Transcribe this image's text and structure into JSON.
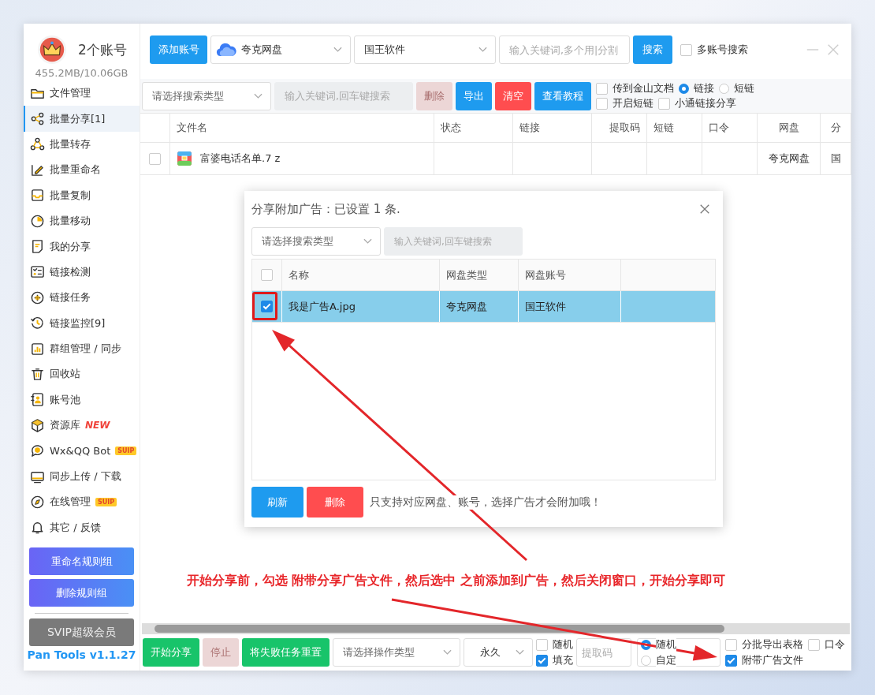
{
  "header": {
    "account_count": "2个账号",
    "storage": "455.2MB/10.06GB",
    "add_account_button": "添加账号",
    "drive_select": "夸克网盘",
    "account_select": "国王软件",
    "keyword_field": {
      "placeholder": "输入关键词,多个用|分割"
    },
    "search_button": "搜索",
    "multi_account_search": {
      "label": "多账号搜索",
      "checked": false
    }
  },
  "sidebar": {
    "items": [
      {
        "label": "文件管理",
        "selected": false
      },
      {
        "label": "批量分享[1]",
        "selected": true
      },
      {
        "label": "批量转存",
        "selected": false
      },
      {
        "label": "批量重命名",
        "selected": false
      },
      {
        "label": "批量复制",
        "selected": false
      },
      {
        "label": "批量移动",
        "selected": false
      },
      {
        "label": "我的分享",
        "selected": false
      },
      {
        "label": "链接检测",
        "selected": false
      },
      {
        "label": "链接任务",
        "selected": false
      },
      {
        "label": "链接监控[9]",
        "selected": false
      },
      {
        "label": "群组管理 / 同步",
        "selected": false
      },
      {
        "label": "回收站",
        "selected": false
      },
      {
        "label": "账号池",
        "selected": false
      },
      {
        "label": "资源库",
        "selected": false,
        "badge": {
          "text": "NEW",
          "kind": "new"
        }
      },
      {
        "label": "Wx&QQ Bot",
        "selected": false,
        "badge": {
          "text": "SUIP",
          "kind": "suip"
        }
      },
      {
        "label": "同步上传 / 下载",
        "selected": false
      },
      {
        "label": "在线管理",
        "selected": false,
        "badge": {
          "text": "SUIP",
          "kind": "suip"
        }
      },
      {
        "label": "其它 / 反馈",
        "selected": false
      }
    ],
    "rule_buttons": [
      "重命名规则组",
      "删除规则组"
    ],
    "svip_button": "SVIP超级会员",
    "version": "Pan Tools v1.1.27"
  },
  "toolbar": {
    "search_type_select": {
      "placeholder": "请选择搜索类型"
    },
    "keyword_field": {
      "placeholder": "输入关键词,回车键搜索"
    },
    "buttons": [
      {
        "label": "删除",
        "kind": "danger",
        "disabled": true
      },
      {
        "label": "导出",
        "kind": "primary",
        "disabled": false
      },
      {
        "label": "清空",
        "kind": "danger",
        "disabled": false
      },
      {
        "label": "查看教程",
        "kind": "primary",
        "disabled": false
      }
    ],
    "options": [
      [
        {
          "kind": "checkbox",
          "label": "传到金山文档",
          "checked": false
        },
        {
          "kind": "radio",
          "label": "链接",
          "selected": true
        },
        {
          "kind": "radio",
          "label": "短链",
          "selected": false
        }
      ],
      [
        {
          "kind": "checkbox",
          "label": "开启短链",
          "checked": false
        },
        {
          "kind": "checkbox",
          "label": "小通链接分享",
          "checked": false
        }
      ]
    ]
  },
  "table": {
    "columns": [
      "文件名",
      "状态",
      "链接",
      "提取码",
      "短链",
      "口令",
      "网盘",
      "分"
    ],
    "rows": [
      {
        "checked": false,
        "file_name": "富婆电话名单.7 z",
        "drive": "夸克网盘",
        "share": "国"
      }
    ]
  },
  "dialog": {
    "title": "分享附加广告：已设置 1 条.",
    "search_type_select": {
      "placeholder": "请选择搜索类型"
    },
    "keyword_field": {
      "placeholder": "输入关键词,回车键搜索"
    },
    "all_checked": false,
    "columns": [
      "名称",
      "网盘类型",
      "网盘账号"
    ],
    "rows": [
      {
        "selected": true,
        "checked": true,
        "name": "我是广告A.jpg",
        "drive_type": "夸克网盘",
        "account": "国王软件"
      }
    ],
    "buttons": [
      {
        "label": "刷新",
        "kind": "primary"
      },
      {
        "label": "删除",
        "kind": "danger"
      }
    ],
    "note": "只支持对应网盘、账号，选择广告才会附加哦！"
  },
  "annotation": "开始分享前，勾选 附带分享广告文件，然后选中 之前添加到广告，然后关闭窗口，开始分享即可",
  "bottom_bar": {
    "buttons": [
      {
        "label": "开始分享",
        "kind": "success",
        "disabled": false
      },
      {
        "label": "停止",
        "kind": "danger",
        "disabled": true
      },
      {
        "label": "将失败任务重置",
        "kind": "success",
        "disabled": false
      }
    ],
    "operation_type_select": {
      "placeholder": "请选择操作类型"
    },
    "expiry_select": "永久",
    "code_options": [
      {
        "label": "随机",
        "checked": false
      },
      {
        "label": "填充",
        "checked": true
      }
    ],
    "code_field": {
      "placeholder": "提取码"
    },
    "code_mode": [
      {
        "label": "随机",
        "selected": true
      },
      {
        "label": "自定",
        "selected": false
      }
    ],
    "export_options": [
      {
        "label": "分批导出表格",
        "checked": false
      },
      {
        "label": "口令",
        "checked": false
      },
      {
        "label": "附带广告文件",
        "checked": true
      }
    ]
  }
}
